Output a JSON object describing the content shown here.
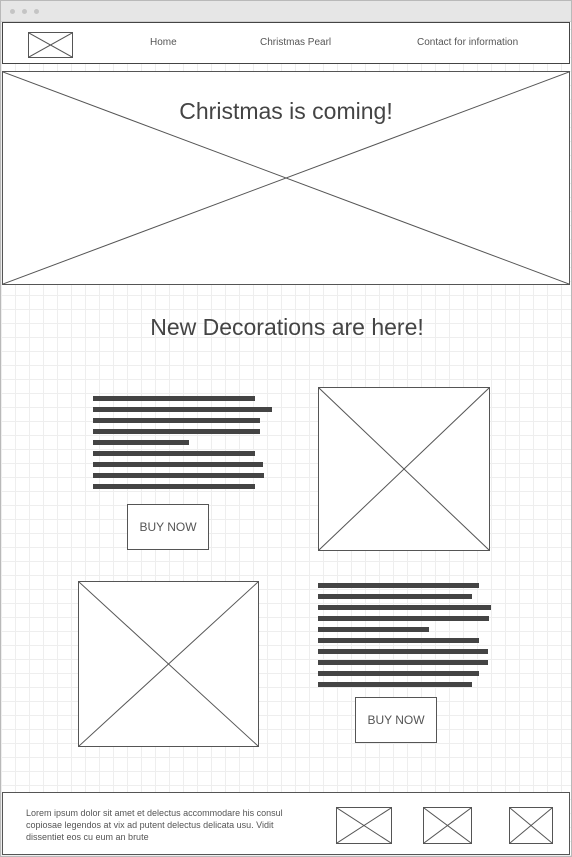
{
  "nav": {
    "logo_icon": "image-placeholder-icon",
    "links": [
      "Home",
      "Christmas Pearl",
      "Contact for information"
    ]
  },
  "hero": {
    "title": "Christmas is coming!",
    "background_icon": "image-placeholder-icon"
  },
  "section": {
    "title": "New Decorations are here!"
  },
  "products": [
    {
      "button_label": "BUY NOW",
      "image_icon": "image-placeholder-icon"
    },
    {
      "button_label": "BUY NOW",
      "image_icon": "image-placeholder-icon"
    }
  ],
  "footer": {
    "text": "Lorem ipsum dolor sit amet et delectus accommodare his consul copiosae legendos at vix ad putent delectus delicata usu. Vidit dissentiet eos cu eum an brute",
    "social_icons": [
      "image-placeholder-icon",
      "image-placeholder-icon",
      "image-placeholder-icon"
    ]
  },
  "colors": {
    "stroke": "#444444",
    "grid": "#eeeeee",
    "titlebar": "#e6e6e6"
  }
}
